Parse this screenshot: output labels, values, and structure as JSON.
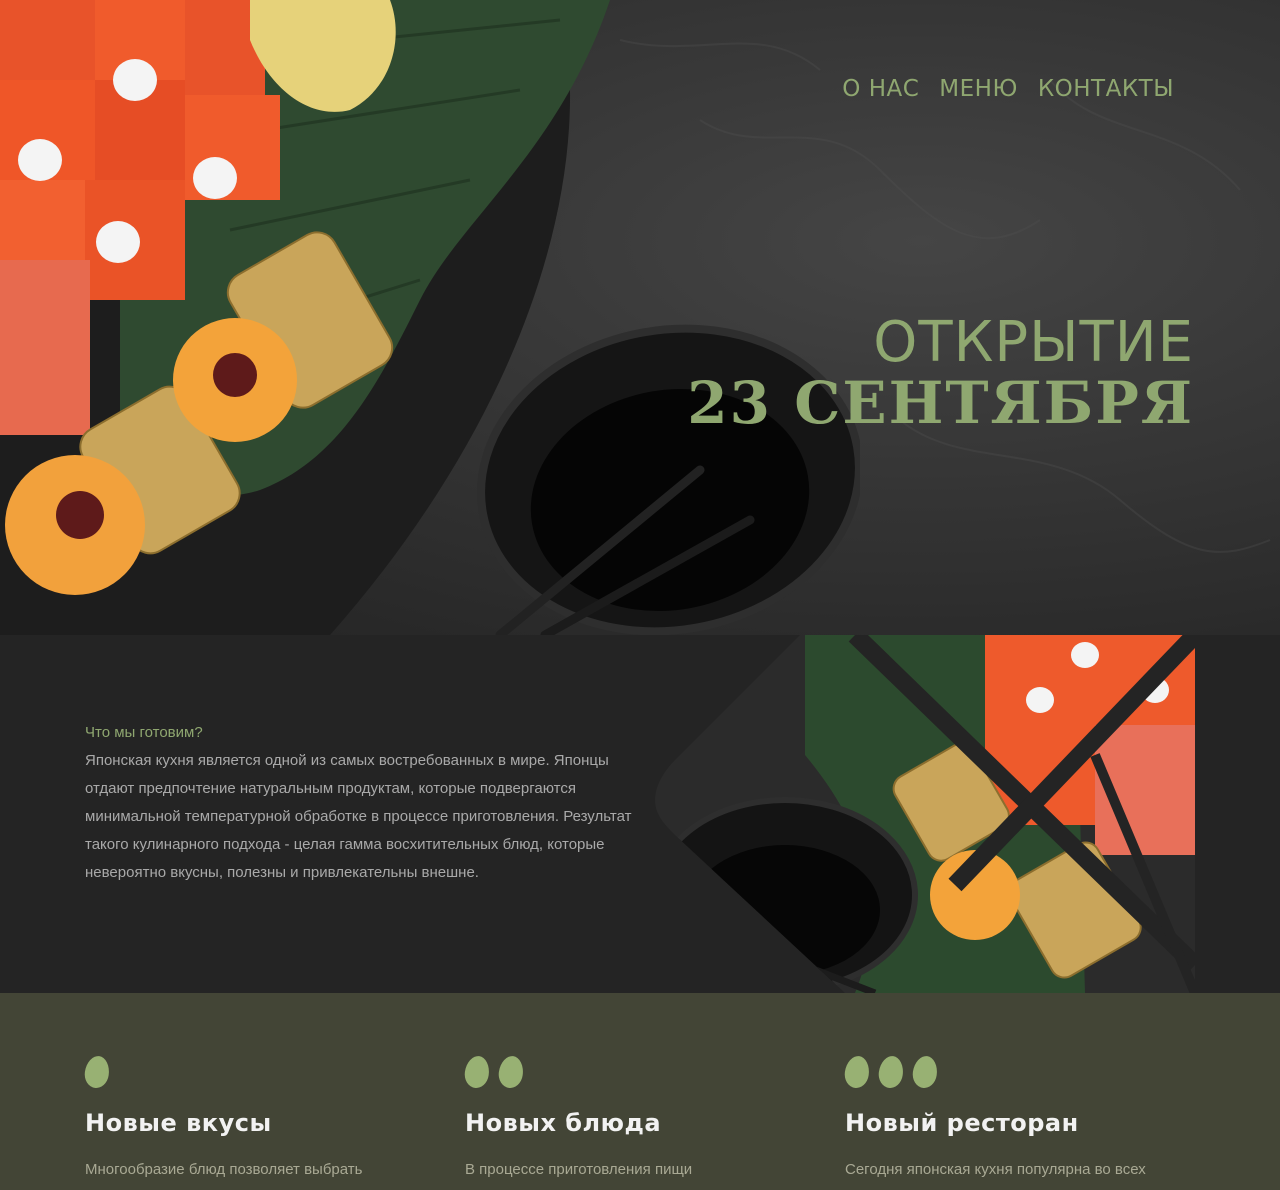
{
  "nav": {
    "items": [
      {
        "label": "О НАС"
      },
      {
        "label": "МЕНЮ"
      },
      {
        "label": "КОНТАКТЫ"
      }
    ]
  },
  "hero": {
    "line1": "ОТКРЫТИЕ",
    "line2": "23 СЕНТЯБРЯ"
  },
  "about": {
    "heading": "Что мы готовим?",
    "body": "Японская кухня является одной из самых востребованных в мире. Японцы отдают предпочтение натуральным продуктам, которые подвергаются минимальной температурной обработке в процессе приготовления. Результат такого кулинарного подхода - целая гамма восхитительных блюд, которые невероятно вкусны, полезны и привлекательны внешне."
  },
  "features": [
    {
      "dots": 1,
      "title": "Новые вкусы",
      "text": "Многообразие блюд позволяет выбрать"
    },
    {
      "dots": 2,
      "title": "Новых блюда",
      "text": "В процессе приготовления пищи"
    },
    {
      "dots": 3,
      "title": "Новый ресторан",
      "text": "Сегодня японская кухня популярна во всех"
    }
  ],
  "colors": {
    "accent": "#8fa770",
    "dark_bg": "#242424",
    "features_bg": "#434536"
  }
}
